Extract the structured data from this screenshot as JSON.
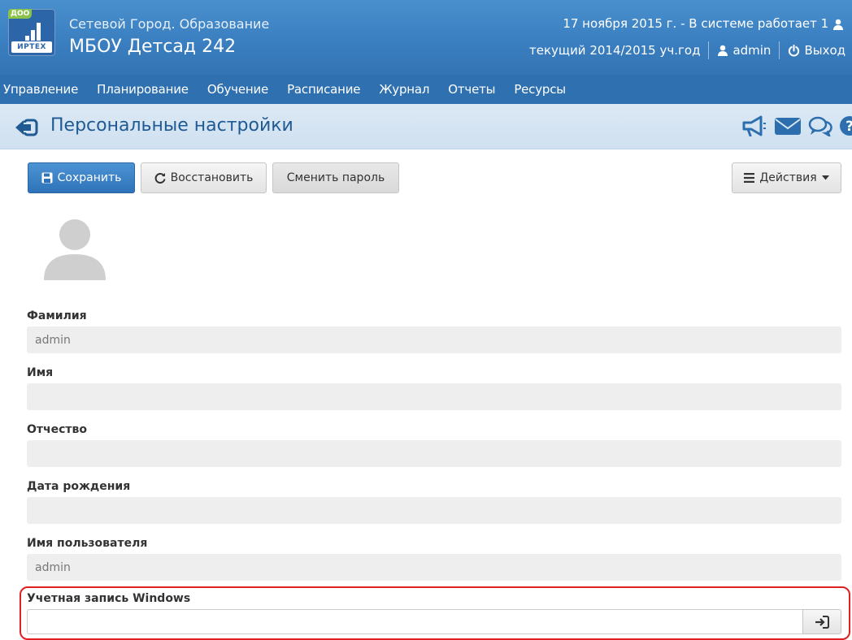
{
  "header": {
    "logo_badge": "ДОО",
    "logo_brand": "ИРТЕХ",
    "subtitle": "Сетевой Город. Образование",
    "title": "МБОУ Детсад 242",
    "status": "17 ноября 2015 г. - В системе работает 1",
    "year": "текущий 2014/2015 уч.год",
    "user": "admin",
    "logout": "Выход"
  },
  "nav": {
    "items": [
      "Управление",
      "Планирование",
      "Обучение",
      "Расписание",
      "Журнал",
      "Отчеты",
      "Ресурсы"
    ]
  },
  "page": {
    "title": "Персональные настройки"
  },
  "toolbar": {
    "save": "Сохранить",
    "restore": "Восстановить",
    "change_password": "Сменить пароль",
    "actions": "Действия"
  },
  "form": {
    "fields": [
      {
        "label": "Фамилия",
        "value": "admin"
      },
      {
        "label": "Имя",
        "value": ""
      },
      {
        "label": "Отчество",
        "value": ""
      },
      {
        "label": "Дата рождения",
        "value": ""
      },
      {
        "label": "Имя пользователя",
        "value": "admin"
      }
    ],
    "windows_account": {
      "label": "Учетная запись Windows",
      "value": ""
    }
  },
  "colors": {
    "header": "#3a7fc0",
    "nav": "#2f70b0",
    "title_bar": "#d6e6f4",
    "primary_button": "#3a83c6",
    "highlight": "#e02020"
  }
}
